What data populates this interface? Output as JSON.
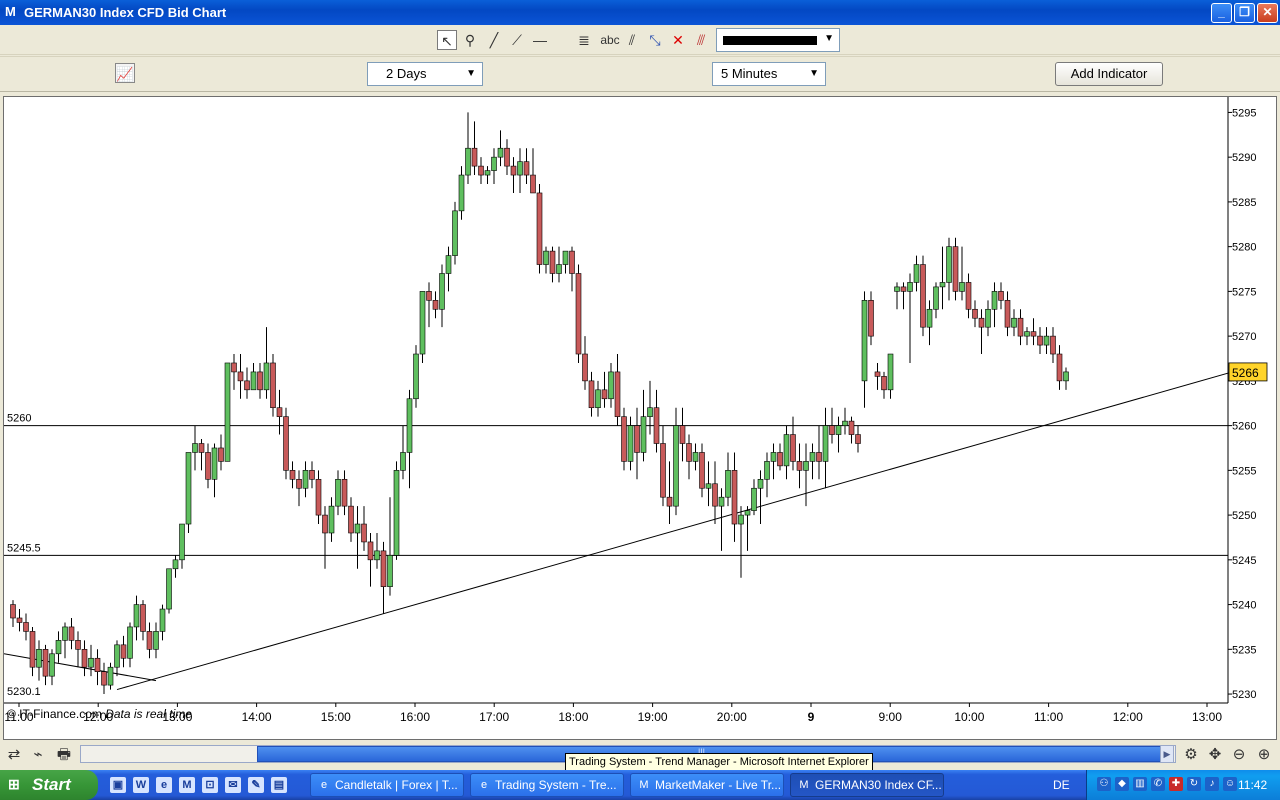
{
  "window": {
    "title": "GERMAN30 Index CFD Bid Chart",
    "minimize": "_",
    "maximize": "❐",
    "close": "✕"
  },
  "toolbar": {
    "text_tool_label": "abc",
    "line_color": "#000000"
  },
  "controls": {
    "period": "2 Days",
    "interval": "5 Minutes",
    "add_indicator": "Add Indicator"
  },
  "chart_data": {
    "type": "candlestick",
    "y_ticks": [
      5230,
      5235,
      5240,
      5245,
      5250,
      5255,
      5260,
      5265,
      5270,
      5275,
      5280,
      5285,
      5290,
      5295
    ],
    "ylim": [
      5229,
      5296.5
    ],
    "x_ticks": [
      "11:00",
      "12:00",
      "13:00",
      "14:00",
      "15:00",
      "16:00",
      "17:00",
      "18:00",
      "19:00",
      "20:00",
      "9",
      "9:00",
      "10:00",
      "11:00",
      "12:00",
      "13:00"
    ],
    "current_price": "5266",
    "horizontal_lines": [
      {
        "label": "5260",
        "value": 5260
      },
      {
        "label": "5245.5",
        "value": 5245.5
      }
    ],
    "bottom_label": "5230.1",
    "footer": "© IT-Finance.com",
    "footer_note": "Data is real time",
    "trendlines": [
      {
        "from": [
          0,
          5234.5
        ],
        "to": [
          22,
          5231.5
        ]
      },
      {
        "from": [
          16,
          5230.5
        ],
        "to": [
          190,
          5266.5
        ]
      }
    ],
    "candles": [
      [
        5240,
        5240.5,
        5237.5,
        5238.5
      ],
      [
        5238.5,
        5239.5,
        5237,
        5238
      ],
      [
        5238,
        5239,
        5236,
        5237
      ],
      [
        5237,
        5237.5,
        5232,
        5233
      ],
      [
        5233,
        5236,
        5231.5,
        5235
      ],
      [
        5235,
        5235.5,
        5231,
        5232
      ],
      [
        5232,
        5235,
        5231,
        5234.5
      ],
      [
        5234.5,
        5237,
        5233.5,
        5236
      ],
      [
        5236,
        5238,
        5234,
        5237.5
      ],
      [
        5237.5,
        5238.5,
        5235,
        5236
      ],
      [
        5236,
        5237,
        5233,
        5235
      ],
      [
        5235,
        5236,
        5232,
        5233
      ],
      [
        5233,
        5235.5,
        5232,
        5234
      ],
      [
        5234,
        5235,
        5231,
        5232.5
      ],
      [
        5232.5,
        5233.5,
        5230,
        5231
      ],
      [
        5231,
        5233.5,
        5230.5,
        5233
      ],
      [
        5233,
        5236,
        5232,
        5235.5
      ],
      [
        5235.5,
        5236.5,
        5233,
        5234
      ],
      [
        5234,
        5238,
        5233,
        5237.5
      ],
      [
        5237.5,
        5241,
        5236,
        5240
      ],
      [
        5240,
        5240.5,
        5236,
        5237
      ],
      [
        5237,
        5238,
        5234,
        5235
      ],
      [
        5235,
        5238,
        5234,
        5237
      ],
      [
        5237,
        5240,
        5236,
        5239.5
      ],
      [
        5239.5,
        5244,
        5239,
        5244
      ],
      [
        5244,
        5245.5,
        5243,
        5245
      ],
      [
        5245,
        5249,
        5244,
        5249
      ],
      [
        5249,
        5257,
        5248,
        5257
      ],
      [
        5257,
        5260,
        5255,
        5258
      ],
      [
        5258,
        5258.5,
        5255,
        5257
      ],
      [
        5257,
        5258,
        5253,
        5254
      ],
      [
        5254,
        5258,
        5252,
        5257.5
      ],
      [
        5257.5,
        5259,
        5255,
        5256
      ],
      [
        5256,
        5267,
        5256,
        5267
      ],
      [
        5267,
        5268,
        5264,
        5266
      ],
      [
        5266,
        5268,
        5263,
        5265
      ],
      [
        5265,
        5266.5,
        5263,
        5264
      ],
      [
        5264,
        5267,
        5264,
        5266
      ],
      [
        5266,
        5267,
        5263,
        5264
      ],
      [
        5264,
        5271,
        5263,
        5267
      ],
      [
        5267,
        5268,
        5261,
        5262
      ],
      [
        5262,
        5264,
        5259,
        5261
      ],
      [
        5261,
        5262,
        5254,
        5255
      ],
      [
        5255,
        5256,
        5253,
        5254
      ],
      [
        5254,
        5255,
        5251,
        5253
      ],
      [
        5253,
        5256,
        5252,
        5255
      ],
      [
        5255,
        5256,
        5253,
        5254
      ],
      [
        5254,
        5255,
        5249,
        5250
      ],
      [
        5250,
        5251,
        5244,
        5248
      ],
      [
        5248,
        5252,
        5247,
        5251
      ],
      [
        5251,
        5255,
        5250,
        5254
      ],
      [
        5254,
        5255,
        5250,
        5251
      ],
      [
        5251,
        5252,
        5247,
        5248
      ],
      [
        5248,
        5251,
        5244,
        5249
      ],
      [
        5249,
        5251,
        5246,
        5247
      ],
      [
        5247,
        5248,
        5242,
        5245
      ],
      [
        5245,
        5248,
        5244,
        5246
      ],
      [
        5246,
        5247,
        5239,
        5242
      ],
      [
        5242,
        5252,
        5241,
        5245.5
      ],
      [
        5245.5,
        5256,
        5245,
        5255
      ],
      [
        5255,
        5260,
        5254,
        5257
      ],
      [
        5257,
        5264,
        5253,
        5263
      ],
      [
        5263,
        5269,
        5262,
        5268
      ],
      [
        5268,
        5275,
        5267,
        5275
      ],
      [
        5275,
        5276,
        5271,
        5274
      ],
      [
        5274,
        5275,
        5272,
        5273
      ],
      [
        5273,
        5278,
        5271,
        5277
      ],
      [
        5277,
        5280,
        5275,
        5279
      ],
      [
        5279,
        5285,
        5278,
        5284
      ],
      [
        5284,
        5289,
        5283,
        5288
      ],
      [
        5288,
        5295,
        5287,
        5291
      ],
      [
        5291,
        5294,
        5288,
        5289
      ],
      [
        5289,
        5290,
        5287,
        5288
      ],
      [
        5288,
        5289,
        5287,
        5288.5
      ],
      [
        5288.5,
        5291,
        5287,
        5290
      ],
      [
        5290,
        5293,
        5289,
        5291
      ],
      [
        5291,
        5292,
        5288,
        5289
      ],
      [
        5289,
        5290,
        5286,
        5288
      ],
      [
        5288,
        5291,
        5286,
        5289.5
      ],
      [
        5289.5,
        5291,
        5287,
        5288
      ],
      [
        5288,
        5291,
        5286,
        5286
      ],
      [
        5286,
        5287,
        5277,
        5278
      ],
      [
        5278,
        5280,
        5277,
        5279.5
      ],
      [
        5279.5,
        5280,
        5276,
        5277
      ],
      [
        5277,
        5280,
        5276,
        5278
      ],
      [
        5278,
        5279,
        5277,
        5279.5
      ],
      [
        5279.5,
        5280,
        5275,
        5277
      ],
      [
        5277,
        5278,
        5267,
        5268
      ],
      [
        5268,
        5270,
        5264,
        5265
      ],
      [
        5265,
        5266,
        5261,
        5262
      ],
      [
        5262,
        5265,
        5261,
        5264
      ],
      [
        5264,
        5266,
        5262,
        5263
      ],
      [
        5263,
        5267,
        5262,
        5266
      ],
      [
        5266,
        5268,
        5260,
        5261
      ],
      [
        5261,
        5262,
        5255,
        5256
      ],
      [
        5256,
        5261,
        5255,
        5260
      ],
      [
        5260,
        5262,
        5254,
        5257
      ],
      [
        5257,
        5264,
        5256,
        5261
      ],
      [
        5261,
        5265,
        5259,
        5262
      ],
      [
        5262,
        5264,
        5257,
        5258
      ],
      [
        5258,
        5260,
        5251,
        5252
      ],
      [
        5252,
        5256,
        5249,
        5251
      ],
      [
        5251,
        5262,
        5250,
        5260
      ],
      [
        5260,
        5262,
        5256,
        5258
      ],
      [
        5258,
        5259,
        5254,
        5256
      ],
      [
        5256,
        5258,
        5255,
        5257
      ],
      [
        5257,
        5258,
        5252,
        5253
      ],
      [
        5253,
        5256,
        5251,
        5253.5
      ],
      [
        5253.5,
        5256,
        5249,
        5251
      ],
      [
        5251,
        5253,
        5246,
        5252
      ],
      [
        5252,
        5257,
        5251,
        5255
      ],
      [
        5255,
        5257,
        5247,
        5249
      ],
      [
        5249,
        5251,
        5243,
        5250
      ],
      [
        5250,
        5251,
        5246,
        5250.5
      ],
      [
        5250.5,
        5254,
        5250,
        5253
      ],
      [
        5253,
        5255,
        5249,
        5254
      ],
      [
        5254,
        5257,
        5252,
        5256
      ],
      [
        5256,
        5258,
        5254,
        5257
      ],
      [
        5257,
        5258,
        5255,
        5255.5
      ],
      [
        5255.5,
        5260,
        5254,
        5259
      ],
      [
        5259,
        5261,
        5255,
        5256
      ],
      [
        5256,
        5258,
        5253,
        5255
      ],
      [
        5255,
        5258,
        5251,
        5256
      ],
      [
        5256,
        5258,
        5254,
        5257
      ],
      [
        5257,
        5260,
        5254,
        5256
      ],
      [
        5256,
        5262,
        5253,
        5260
      ],
      [
        5260,
        5262,
        5258,
        5259
      ],
      [
        5259,
        5261,
        5257,
        5260
      ],
      [
        5260,
        5262,
        5259,
        5260.5
      ],
      [
        5260.5,
        5261,
        5258,
        5259
      ],
      [
        5259,
        5260,
        5257,
        5258
      ],
      [
        5265,
        5275,
        5262,
        5274
      ],
      [
        5274,
        5275,
        5269,
        5270
      ],
      [
        5266,
        5267,
        5264,
        5265.5
      ],
      [
        5265.5,
        5266,
        5263,
        5264
      ],
      [
        5264,
        5268,
        5263,
        5268
      ],
      [
        5275,
        5276,
        5273,
        5275.5
      ],
      [
        5275.5,
        5276,
        5273,
        5275
      ],
      [
        5275,
        5277,
        5267,
        5276
      ],
      [
        5276,
        5279,
        5275,
        5278
      ],
      [
        5278,
        5279,
        5270,
        5271
      ],
      [
        5271,
        5274,
        5269,
        5273
      ],
      [
        5273,
        5276,
        5272,
        5275.5
      ],
      [
        5275.5,
        5280,
        5273,
        5276
      ],
      [
        5276,
        5281,
        5274,
        5280
      ],
      [
        5280,
        5281,
        5274,
        5275
      ],
      [
        5275,
        5280,
        5274,
        5276
      ],
      [
        5276,
        5277,
        5272,
        5273
      ],
      [
        5273,
        5274,
        5271,
        5272
      ],
      [
        5272,
        5273,
        5268,
        5271
      ],
      [
        5271,
        5274,
        5270,
        5273
      ],
      [
        5273,
        5276,
        5271,
        5275
      ],
      [
        5275,
        5276,
        5273,
        5274
      ],
      [
        5274,
        5275,
        5270,
        5271
      ],
      [
        5271,
        5273,
        5270,
        5272
      ],
      [
        5272,
        5273,
        5269,
        5270
      ],
      [
        5270,
        5271,
        5269,
        5270.5
      ],
      [
        5270.5,
        5272,
        5269,
        5270
      ],
      [
        5270,
        5271,
        5268,
        5269
      ],
      [
        5269,
        5271,
        5268,
        5270
      ],
      [
        5270,
        5271,
        5267,
        5268
      ],
      [
        5268,
        5269,
        5264,
        5265
      ],
      [
        5265,
        5266.5,
        5264,
        5266
      ]
    ]
  },
  "scrollbar": {
    "grip": "|||"
  },
  "tooltip": "Trading System - Trend Manager - Microsoft Internet Explorer",
  "taskbar": {
    "start": "Start",
    "tasks": [
      {
        "label": "Candletalk | Forex | T...",
        "icon": "ie"
      },
      {
        "label": "Trading System - Tre...",
        "icon": "ie"
      },
      {
        "label": "MarketMaker - Live Tr...",
        "icon": "mm"
      },
      {
        "label": "GERMAN30 Index CF...",
        "icon": "mm"
      }
    ],
    "language": "DE",
    "clock": "11:42"
  },
  "colors": {
    "bull": "#5fbf5f",
    "bear": "#c85a5a",
    "price_tag": "#ffd42a"
  }
}
